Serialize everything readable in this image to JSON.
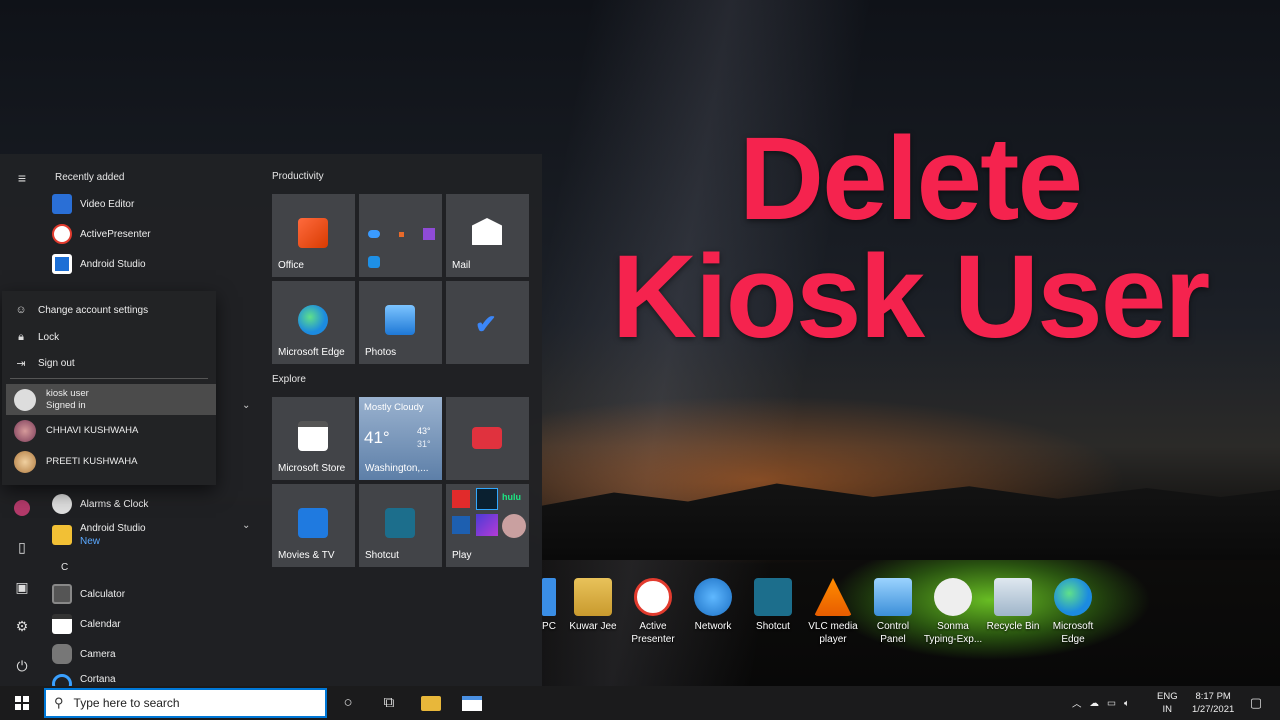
{
  "overlay": {
    "line1": "Delete",
    "line2": "Kiosk User",
    "color": "#f5234e"
  },
  "start_menu": {
    "recently_added_label": "Recently added",
    "recent_apps": [
      {
        "label": "Video Editor",
        "icon": "video-editor-icon"
      },
      {
        "label": "ActivePresenter",
        "icon": "activepresenter-icon"
      },
      {
        "label": "Android Studio",
        "icon": "android-studio-icon"
      }
    ],
    "account_menu": {
      "change_settings": "Change account settings",
      "lock": "Lock",
      "sign_out": "Sign out",
      "accounts": [
        {
          "name": "kiosk user",
          "status": "Signed in"
        },
        {
          "name": "CHHAVI KUSHWAHA"
        },
        {
          "name": "PREETI KUSHWAHA"
        }
      ]
    },
    "apps": [
      {
        "label": "Alarms & Clock",
        "icon": "alarm-clock-icon"
      },
      {
        "label": "Android Studio",
        "sub": "New",
        "icon": "folder-icon"
      },
      {
        "label": "C",
        "icon": ""
      },
      {
        "label": "Calculator",
        "icon": "calculator-icon"
      },
      {
        "label": "Calendar",
        "icon": "calendar-icon"
      },
      {
        "label": "Camera",
        "icon": "camera-icon"
      },
      {
        "label": "Cortana",
        "icon": "cortana-icon"
      }
    ],
    "groups": {
      "productivity": "Productivity",
      "explore": "Explore"
    },
    "tiles": {
      "office": "Office",
      "mail": "Mail",
      "edge": "Microsoft Edge",
      "photos": "Photos",
      "store": "Microsoft Store",
      "weather": {
        "condition": "Mostly Cloudy",
        "temp": "41°",
        "high": "43°",
        "low": "31°",
        "location": "Washington,..."
      },
      "movies": "Movies & TV",
      "shotcut": "Shotcut",
      "play": "Play"
    }
  },
  "desktop_icons": [
    "PC",
    "Kuwar Jee",
    "Active Presenter",
    "Network",
    "Shotcut",
    "VLC media player",
    "Control Panel",
    "Sonma Typing-Exp...",
    "Recycle Bin",
    "Microsoft Edge"
  ],
  "taskbar": {
    "search_placeholder": "Type here to search",
    "lang_top": "ENG",
    "lang_bottom": "IN",
    "time": "8:17 PM",
    "date": "1/27/2021"
  }
}
